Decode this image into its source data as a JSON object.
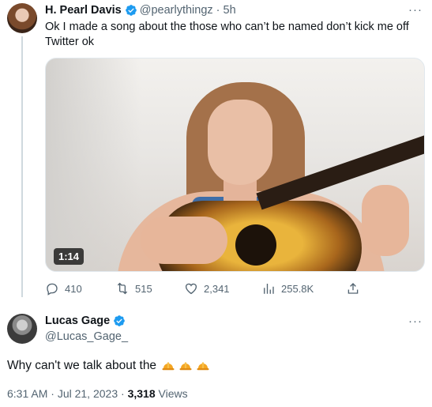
{
  "quoted_tweet": {
    "name": "H. Pearl Davis",
    "handle": "@pearlythingz",
    "separator": "·",
    "time": "5h",
    "text": "Ok I made a song about the those who can’t be named don’t kick me off Twitter ok",
    "video_duration": "1:14",
    "more": "···",
    "actions": {
      "replies": "410",
      "retweets": "515",
      "likes": "2,341",
      "views": "255.8K"
    }
  },
  "tweet": {
    "name": "Lucas Gage",
    "handle": "@Lucas_Gage_",
    "more": "···",
    "text": "Why can't we talk about the",
    "emoji_count": 3,
    "emoji": "construction-hard-hat",
    "time": "6:31 AM",
    "date": "Jul 21, 2023",
    "views_count": "3,318",
    "views_label": "Views",
    "sep": "·"
  },
  "colors": {
    "verified": "#1d9bf0",
    "secondary_text": "#536471",
    "primary_text": "#0f1419",
    "thread_line": "#cfd9de"
  }
}
